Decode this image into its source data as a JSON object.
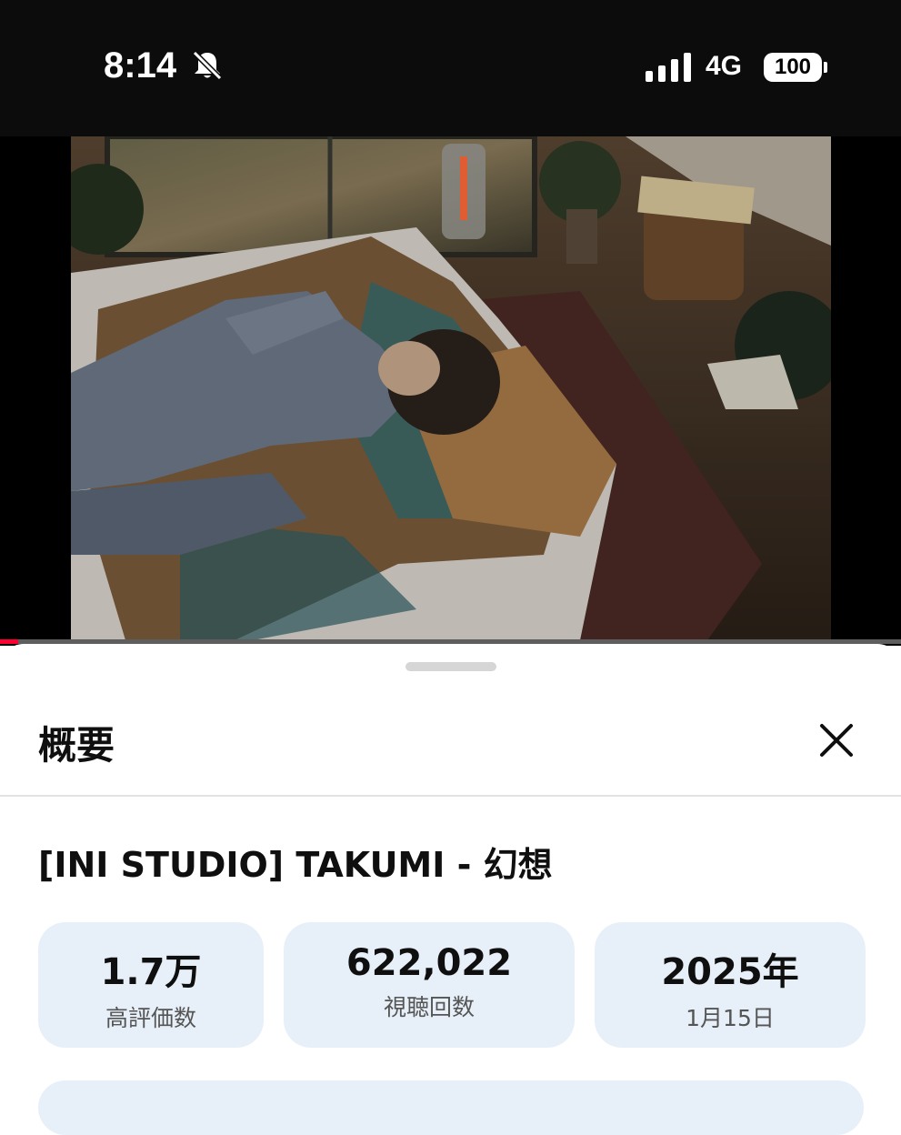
{
  "status_bar": {
    "time": "8:14",
    "network": "4G",
    "battery": "100",
    "silent_icon": "bell-slash-icon",
    "signal_icon": "cellular-signal-icon"
  },
  "player": {
    "progress_fraction": 0.02,
    "progress_color": "#ff0033",
    "frame_description_icon": "video-frame"
  },
  "sheet": {
    "title": "概要",
    "close_icon": "close-icon",
    "video_title": "[INI STUDIO] TAKUMI - 幻想",
    "stats": [
      {
        "value": "1.7万",
        "label": "高評価数"
      },
      {
        "value": "622,022",
        "label": "視聴回数"
      },
      {
        "value": "2025年",
        "label": "1月15日"
      }
    ],
    "card_color": "#e7f0f9"
  }
}
